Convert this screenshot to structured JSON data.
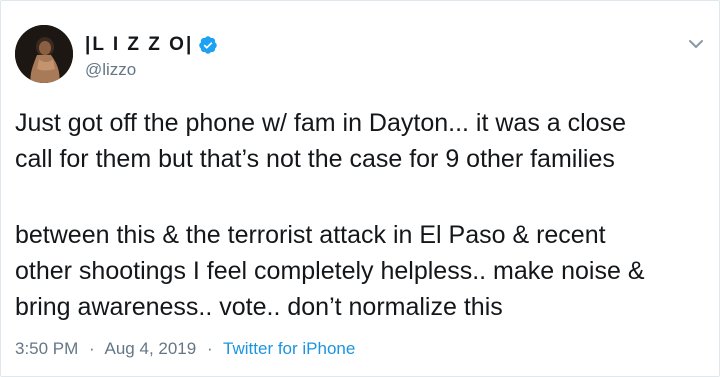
{
  "author": {
    "display_name": "|L I Z Z O|",
    "handle": "@lizzo",
    "verified": true
  },
  "tweet": {
    "paragraph_1": "Just got off the phone w/ fam in Dayton... it was a close\ncall for them but that’s not the case for 9 other families",
    "paragraph_2": "between this & the terrorist attack in El Paso & recent\nother shootings I feel completely helpless.. make noise &\nbring awareness.. vote.. don’t normalize this"
  },
  "meta": {
    "time": "3:50 PM",
    "separator": "·",
    "date": "Aug 4, 2019",
    "source": "Twitter for iPhone"
  },
  "icons": {
    "verified": "verified-badge-icon",
    "caret": "chevron-down-icon"
  },
  "colors": {
    "link_blue": "#1b95e0",
    "secondary_text": "#657786",
    "primary_text": "#14171a"
  }
}
